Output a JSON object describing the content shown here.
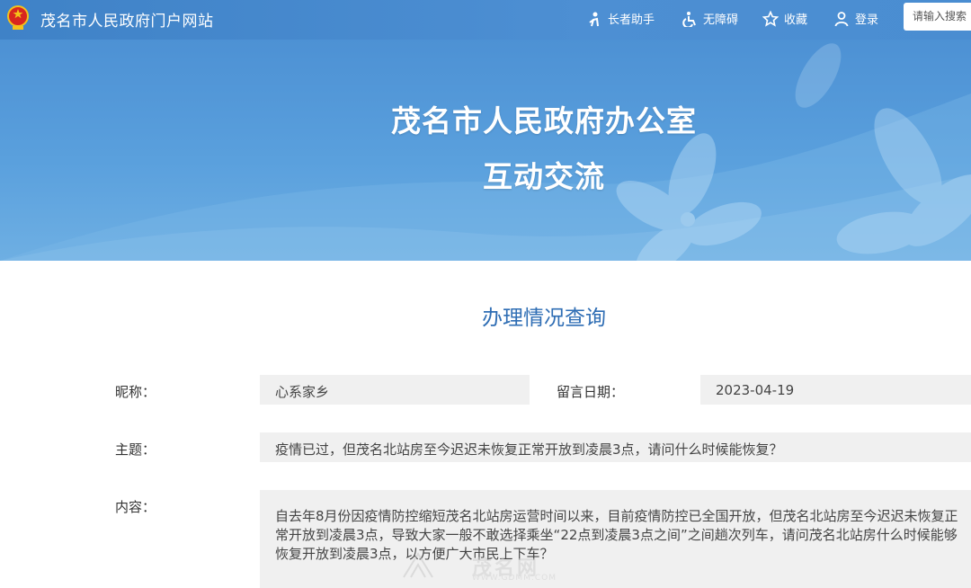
{
  "header": {
    "site_title": "茂名市人民政府门户网站",
    "tools": [
      {
        "label": "长者助手",
        "icon": "elder-icon"
      },
      {
        "label": "无障碍",
        "icon": "wheelchair-icon"
      },
      {
        "label": "收藏",
        "icon": "star-icon"
      },
      {
        "label": "登录",
        "icon": "user-icon"
      }
    ],
    "search_placeholder": "请输入搜索"
  },
  "banner": {
    "title_line1": "茂名市人民政府办公室",
    "title_line2": "互动交流"
  },
  "main": {
    "section_title": "办理情况查询",
    "fields": {
      "nickname_label": "昵称：",
      "nickname_value": "心系家乡",
      "date_label": "留言日期：",
      "date_value": "2023-04-19",
      "subject_label": "主题：",
      "subject_value": "疫情已过，但茂名北站房至今迟迟未恢复正常开放到凌晨3点，请问什么时候能恢复？",
      "content_label": "内容：",
      "content_value": "自去年8月份因疫情防控缩短茂名北站房运营时间以来，目前疫情防控已全国开放，但茂名北站房至今迟迟未恢复正常开放到凌晨3点，导致大家一般不敢选择乘坐“22点到凌晨3点之间”之间趟次列车，请问茂名北站房什么时候能够恢复开放到凌晨3点，以方便广大市民上下车？"
    }
  },
  "watermark": {
    "text": "茂名网",
    "url": "WWW.GDMM.COM"
  },
  "colors": {
    "topbar": "#4a8bd0",
    "banner": "#5aa0dd",
    "section_title": "#2e6db4",
    "field_bg": "#f0f0f0"
  }
}
